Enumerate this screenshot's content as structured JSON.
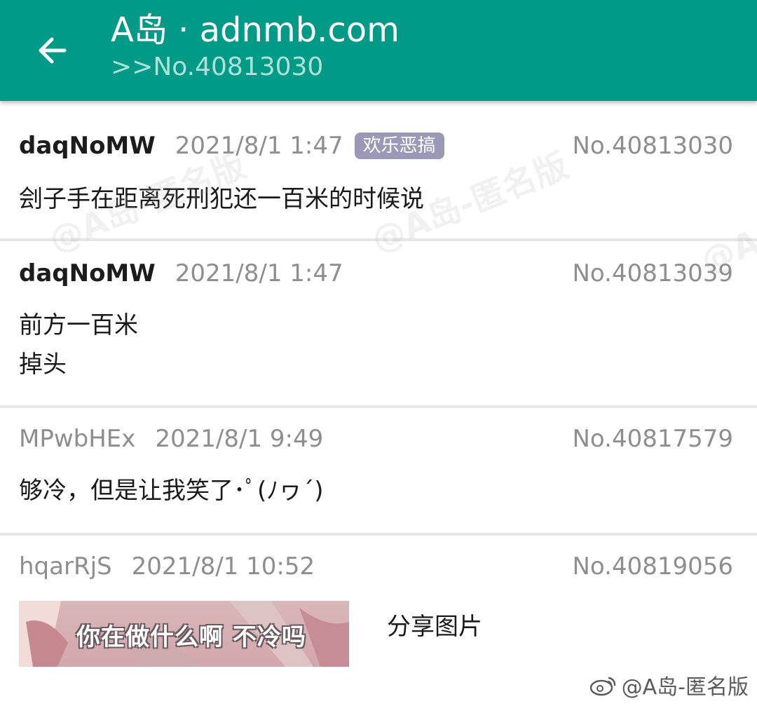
{
  "header": {
    "title": "A岛 · adnmb.com",
    "subtitle": ">>No.40813030"
  },
  "posts": [
    {
      "uid": "daqNoMW",
      "time": "2021/8/1 1:47",
      "tag": "欢乐恶搞",
      "pid": "No.40813030",
      "content": "刽子手在距离死刑犯还一百米的时候说"
    },
    {
      "uid": "daqNoMW",
      "time": "2021/8/1 1:47",
      "pid": "No.40813039",
      "content": "前方一百米\n掉头"
    },
    {
      "uid": "MPwbHEx",
      "time": "2021/8/1 9:49",
      "pid": "No.40817579",
      "content": "够冷，但是让我笑了･ﾟ(ﾉヮ´)"
    },
    {
      "uid": "hqarRjS",
      "time": "2021/8/1 10:52",
      "pid": "No.40819056",
      "image_caption": "你在做什么啊 不冷吗",
      "content": "分享图片"
    }
  ],
  "watermark": {
    "text": "@A岛-匿名版"
  },
  "colors": {
    "appbar": "#009a87",
    "tag": "#9c98b8"
  }
}
